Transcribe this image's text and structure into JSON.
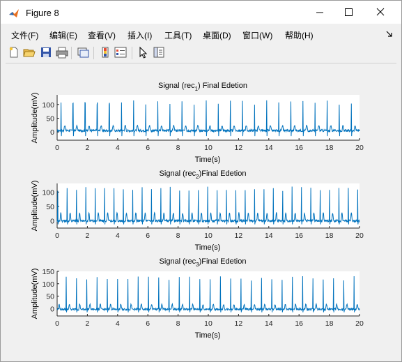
{
  "window": {
    "title": "Figure 8",
    "controls": [
      "minimize",
      "maximize",
      "close"
    ]
  },
  "menu": {
    "items": [
      {
        "label": "文件(F)"
      },
      {
        "label": "编辑(E)"
      },
      {
        "label": "查看(V)"
      },
      {
        "label": "插入(I)"
      },
      {
        "label": "工具(T)"
      },
      {
        "label": "桌面(D)"
      },
      {
        "label": "窗口(W)"
      },
      {
        "label": "帮助(H)"
      }
    ]
  },
  "toolbar": {
    "icons": [
      "new-figure",
      "open-file",
      "save",
      "print",
      "link-plot",
      "insert-colorbar",
      "insert-legend",
      "edit-plot-pointer",
      "property-inspector"
    ]
  },
  "colors": {
    "series": "#0072bd",
    "plot_bg": "#ffffff",
    "figure_bg": "#f0f0f0"
  },
  "chart_data": [
    {
      "type": "line",
      "title_prefix": "Signal (rec",
      "title_sub": "1",
      "title_suffix": ") Final Edetion",
      "xlabel": "Time(s)",
      "ylabel": "Amplitude(mV)",
      "xlim": [
        0,
        20
      ],
      "ylim": [
        -30,
        135
      ],
      "xticks": [
        "0",
        "2",
        "4",
        "6",
        "8",
        "10",
        "12",
        "14",
        "16",
        "18",
        "20"
      ],
      "yticks": [
        "0",
        "50",
        "100"
      ],
      "grid": false,
      "series": [
        {
          "beat_period": 0.8,
          "r_peak": 110,
          "s_trough": -15,
          "baseline": 5,
          "t_wave": 18
        }
      ]
    },
    {
      "type": "line",
      "title_prefix": "Signal (rec",
      "title_sub": "2",
      "title_suffix": ")Final Edetion",
      "xlabel": "Time(s)",
      "ylabel": "Amplitude(mV)",
      "xlim": [
        0,
        20
      ],
      "ylim": [
        -25,
        130
      ],
      "xticks": [
        "0",
        "2",
        "4",
        "6",
        "8",
        "10",
        "12",
        "14",
        "16",
        "18",
        "20"
      ],
      "yticks": [
        "0",
        "50",
        "100"
      ],
      "grid": false,
      "series": [
        {
          "beat_period": 0.62,
          "r_peak": 115,
          "s_trough": -12,
          "baseline": 0,
          "t_wave": 28
        }
      ]
    },
    {
      "type": "line",
      "title_prefix": "Signal (rec",
      "title_sub": "3",
      "title_suffix": ")Final Edetion",
      "xlabel": "Time(s)",
      "ylabel": "Amplitude(mV)",
      "xlim": [
        0,
        20
      ],
      "ylim": [
        -30,
        150
      ],
      "xticks": [
        "0",
        "2",
        "4",
        "6",
        "8",
        "10",
        "12",
        "14",
        "16",
        "18",
        "20"
      ],
      "yticks": [
        "0",
        "50",
        "100",
        "150"
      ],
      "grid": false,
      "series": [
        {
          "beat_period": 0.68,
          "r_peak": 125,
          "s_trough": -15,
          "baseline": -3,
          "t_wave": 20
        }
      ]
    }
  ]
}
